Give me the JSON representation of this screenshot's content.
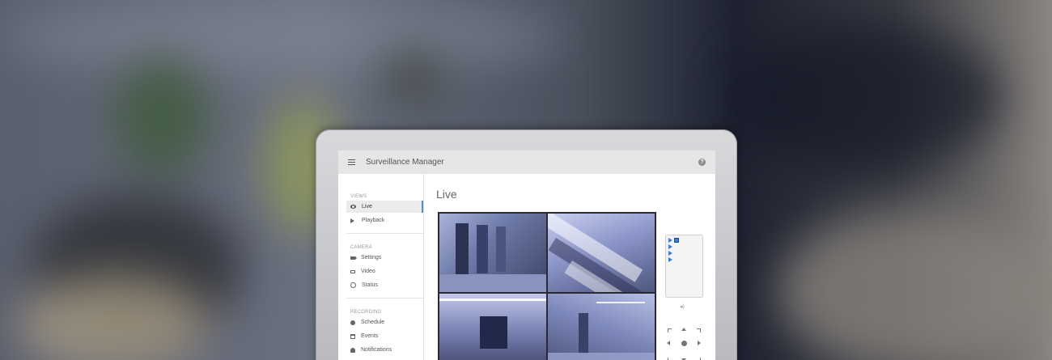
{
  "app": {
    "title": "Surveillance Manager",
    "help_icon": "help-icon",
    "accent": "#4a8fd0"
  },
  "sidebar": {
    "sections": [
      {
        "heading": "VIEWS",
        "items": [
          {
            "label": "Live",
            "icon": "eye-icon",
            "active": true
          },
          {
            "label": "Playback",
            "icon": "play-icon"
          }
        ]
      },
      {
        "heading": "CAMERA",
        "items": [
          {
            "label": "Settings",
            "icon": "camera-icon"
          },
          {
            "label": "Video",
            "icon": "video-icon"
          },
          {
            "label": "Status",
            "icon": "status-icon"
          }
        ]
      },
      {
        "heading": "RECORDING",
        "items": [
          {
            "label": "Schedule",
            "icon": "record-dot-icon"
          },
          {
            "label": "Events",
            "icon": "calendar-icon"
          },
          {
            "label": "Notifications",
            "icon": "bell-icon"
          }
        ]
      }
    ]
  },
  "main": {
    "title": "Live",
    "feeds": [
      "Camera feed 1",
      "Camera feed 2",
      "Camera feed 3",
      "Camera feed 4"
    ],
    "volume_glyph": "◂)"
  }
}
